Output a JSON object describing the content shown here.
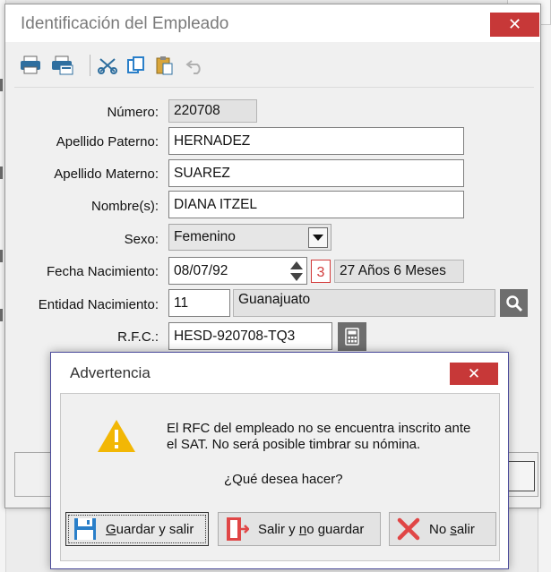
{
  "window": {
    "title": "Identificación del Empleado",
    "close_label": "✕"
  },
  "toolbar": {
    "icons": [
      "printer-icon",
      "print-preview-icon",
      "cut-icon",
      "copy-icon",
      "paste-icon",
      "undo-icon"
    ]
  },
  "form": {
    "numero": {
      "label": "Número:",
      "value": "220708"
    },
    "apellido_paterno": {
      "label": "Apellido Paterno:",
      "value": "HERNADEZ"
    },
    "apellido_materno": {
      "label": "Apellido Materno:",
      "value": "SUAREZ"
    },
    "nombres": {
      "label": "Nombre(s):",
      "value": "DIANA ITZEL"
    },
    "sexo": {
      "label": "Sexo:",
      "value": "Femenino"
    },
    "fecha_nacimiento": {
      "label": "Fecha Nacimiento:",
      "value": "08/07/92",
      "calendar_day": "3",
      "age": "27 Años 6 Meses"
    },
    "entidad_nacimiento": {
      "label": "Entidad Nacimiento:",
      "code": "11",
      "name": "Guanajuato"
    },
    "rfc": {
      "label": "R.F.C.:",
      "value": "HESD-920708-TQ3"
    }
  },
  "dialog": {
    "title": "Advertencia",
    "close_label": "✕",
    "message_line1": "El RFC del empleado no se encuentra inscrito ante",
    "message_line2": "el SAT. No será posible timbrar su nómina.",
    "question": "¿Qué desea hacer?",
    "buttons": {
      "save": {
        "pre": "",
        "mnemonic": "G",
        "post": "uardar y salir"
      },
      "exit": {
        "pre": "Salir y ",
        "mnemonic": "n",
        "post": "o guardar"
      },
      "no_exit": {
        "pre": "No ",
        "mnemonic": "s",
        "post": "alir"
      }
    }
  },
  "colors": {
    "close_red": "#c73838",
    "warning_yellow": "#f2b705",
    "icon_blue": "#2a7fc9",
    "no_red": "#e04646"
  }
}
